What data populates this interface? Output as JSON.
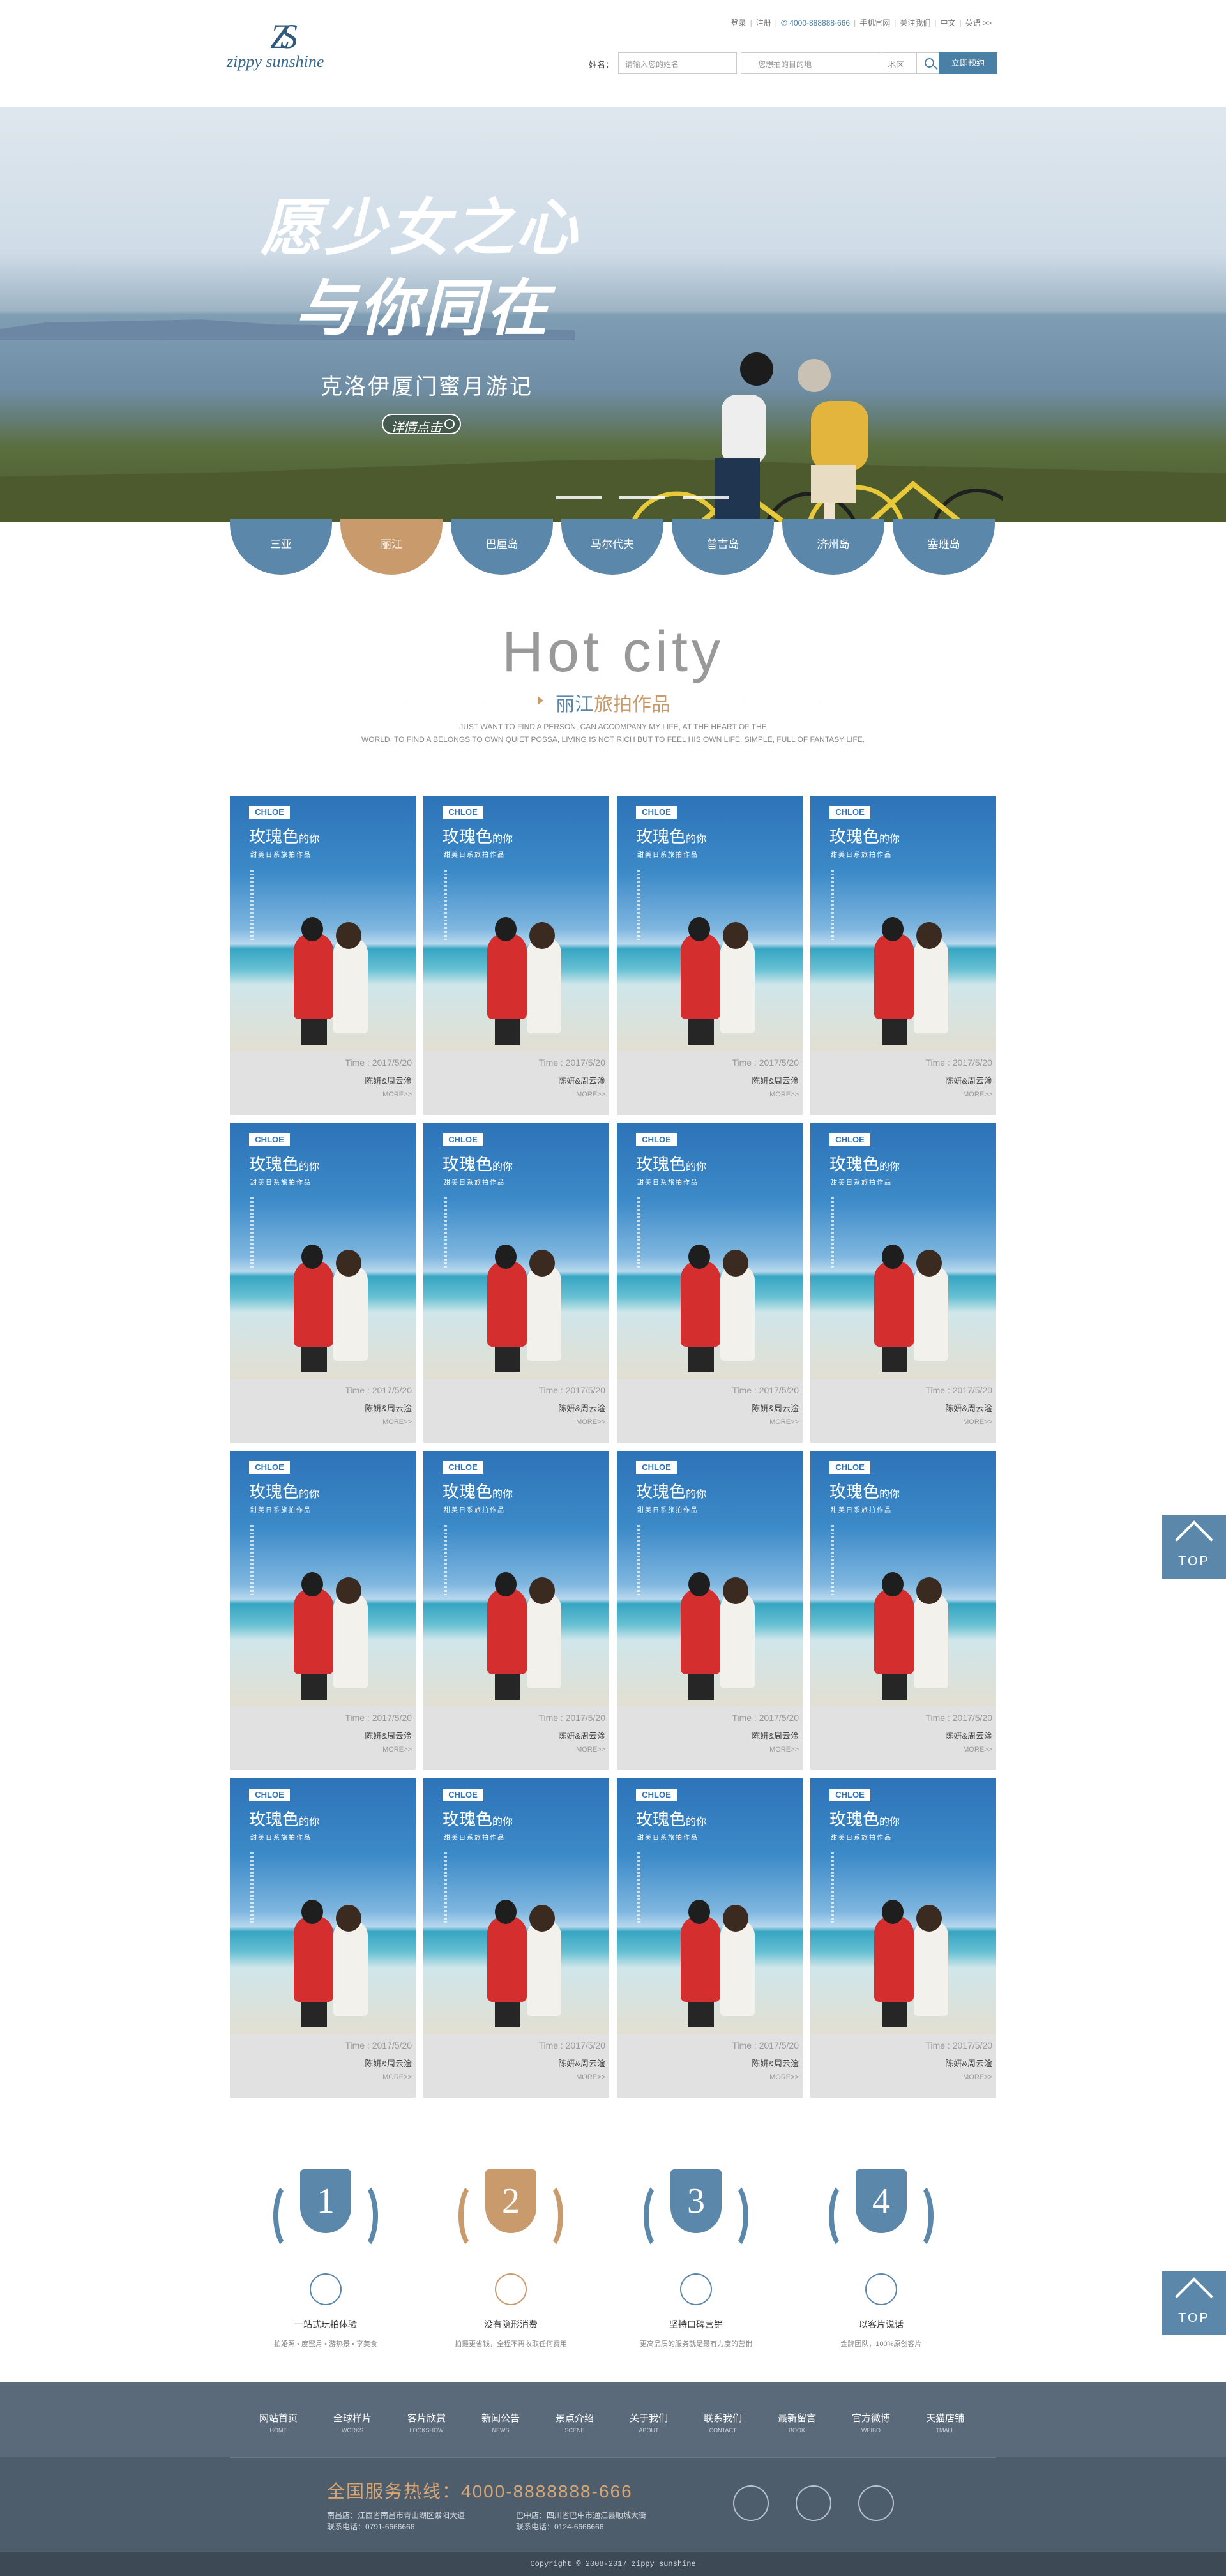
{
  "header": {
    "logo_mark": "ZS",
    "logo_word": "zippy sunshine",
    "links": [
      "登录",
      "注册"
    ],
    "phone": "4000-888888-666",
    "links2": [
      "手机官网",
      "关注我们",
      "中文",
      "英语"
    ],
    "search_label": "姓名：",
    "name_placeholder": "请输入您的姓名",
    "place_placeholder": "您想拍的目的地",
    "place_suffix": "地区",
    "book_label": "立即预约"
  },
  "banner": {
    "title_line1": "愿少女之心",
    "title_line2": "与你同在",
    "subtitle": "克洛伊厦门蜜月游记",
    "more_label": "详情点击"
  },
  "cities": [
    {
      "label": "三亚",
      "active": false
    },
    {
      "label": "丽江",
      "active": true
    },
    {
      "label": "巴厘岛",
      "active": false
    },
    {
      "label": "马尔代夫",
      "active": false
    },
    {
      "label": "普吉岛",
      "active": false
    },
    {
      "label": "济州岛",
      "active": false
    },
    {
      "label": "塞班岛",
      "active": false
    }
  ],
  "hotcity": {
    "title": "Hot city",
    "sub_hl": "丽江",
    "sub_rest": "旅拍作品",
    "desc1": "JUST WANT TO FIND A PERSON, CAN ACCOMPANY MY LIFE, AT THE HEART OF THE",
    "desc2": "WORLD, TO FIND A BELONGS TO OWN QUIET POSSA, LIVING IS NOT RICH BUT TO FEEL HIS OWN LIFE, SIMPLE, FULL OF FANTASY LIFE."
  },
  "card": {
    "tag": "CHLOE",
    "title": "玫瑰色",
    "title_small": "的你",
    "subtitle": "甜美日系旅拍作品",
    "time": "Time : 2017/5/20",
    "name": "陈妍&周云淦",
    "more": "MORE>>"
  },
  "top_label": "TOP",
  "features": [
    {
      "num": "1",
      "title": "一站式玩拍体验",
      "desc": "拍婚照 • 度蜜月 • 游热景 • 享美食",
      "color": "#5b87aa"
    },
    {
      "num": "2",
      "title": "没有隐形消费",
      "desc": "拍摄更省钱，全程不再收取任何费用",
      "color": "#c99a6b"
    },
    {
      "num": "3",
      "title": "坚持口碑营销",
      "desc": "更高品质的服务就是最有力度的营销",
      "color": "#5b87aa"
    },
    {
      "num": "4",
      "title": "以客片说话",
      "desc": "金牌团队，100%原创客片",
      "color": "#5b87aa"
    }
  ],
  "footer_nav": [
    {
      "cn": "网站首页",
      "en": "HOME"
    },
    {
      "cn": "全球样片",
      "en": "WORKS"
    },
    {
      "cn": "客片欣赏",
      "en": "LOOKSHOW"
    },
    {
      "cn": "新闻公告",
      "en": "NEWS"
    },
    {
      "cn": "景点介绍",
      "en": "SCENE"
    },
    {
      "cn": "关于我们",
      "en": "ABOUT"
    },
    {
      "cn": "联系我们",
      "en": "CONTACT"
    },
    {
      "cn": "最新留言",
      "en": "BOOK"
    },
    {
      "cn": "官方微博",
      "en": "WEIBO"
    },
    {
      "cn": "天猫店铺",
      "en": "TMALL"
    }
  ],
  "footer": {
    "hotline": "全国服务热线：4000-8888888-666",
    "addr1_a": "南昌店：江西省南昌市青山湖区紫阳大道",
    "addr1_b": "联系电话：0791-6666666",
    "addr2_a": "巴中店：四川省巴中市通江县顺城大街",
    "addr2_b": "联系电话：0124-6666666",
    "copyright": "Copyright © 2008-2017 zippy sunshine"
  }
}
